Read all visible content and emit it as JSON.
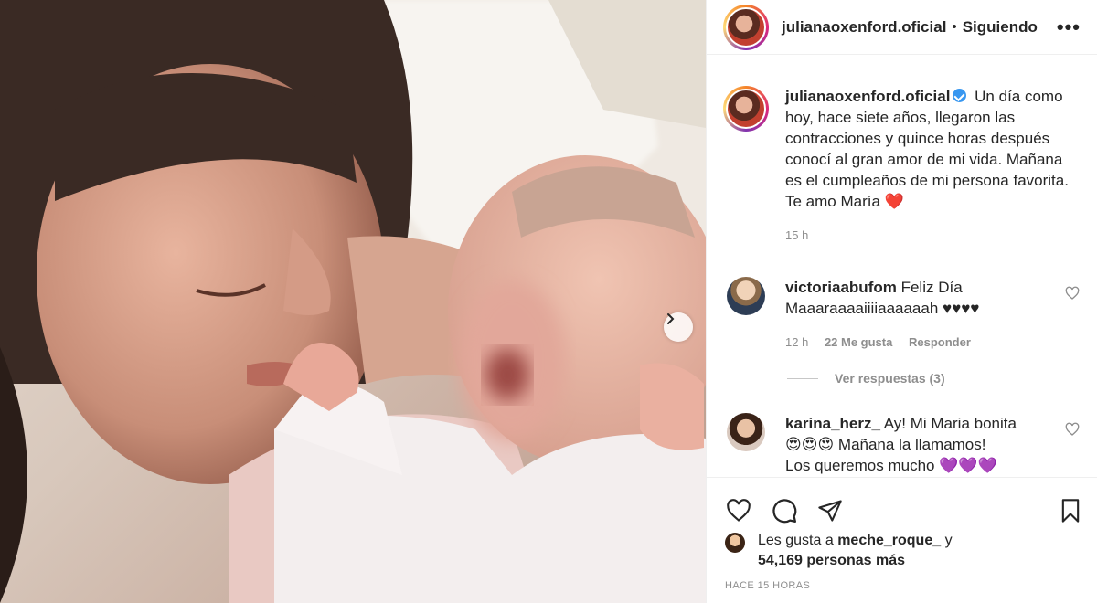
{
  "post": {
    "username": "julianaoxenford.oficial",
    "separator": "•",
    "follow_status": "Siguiendo",
    "more_label": "•••"
  },
  "caption": {
    "username": "julianaoxenford.oficial",
    "text": "Un día como hoy, hace siete años, llegaron las contracciones y quince horas después conocí al gran amor de mi vida. Mañana es el cumpleaños de mi persona favorita. Te amo María",
    "emoji": "❤️",
    "time": "15 h"
  },
  "comments": [
    {
      "username": "victoriaabufom",
      "text": "Feliz Día Maaaraaaaiiiiaaaaaah ♥♥♥♥",
      "time": "12 h",
      "likes": "22 Me gusta",
      "reply": "Responder"
    },
    {
      "username": "karina_herz_",
      "text_1": "Ay! Mi Maria bonita",
      "emoji_1": "😍😍😍",
      "text_2": "Mañana la llamamos!",
      "text_3": "Los queremos mucho",
      "emoji_2": "💜💜💜"
    }
  ],
  "view_replies": "Ver respuestas (3)",
  "likes_summary": {
    "prefix": "Les gusta a",
    "user": "meche_roque_",
    "joiner": "y",
    "count": "54,169 personas más"
  },
  "timestamp": "HACE 15 HORAS",
  "icons": {
    "like": "heart-icon",
    "comment": "comment-icon",
    "share": "send-icon",
    "save": "bookmark-icon",
    "next": "chevron-right-icon",
    "verified": "verified-badge-icon"
  },
  "colors": {
    "verified": "#3897f0",
    "text": "#262626",
    "muted": "#8e8e8e"
  }
}
